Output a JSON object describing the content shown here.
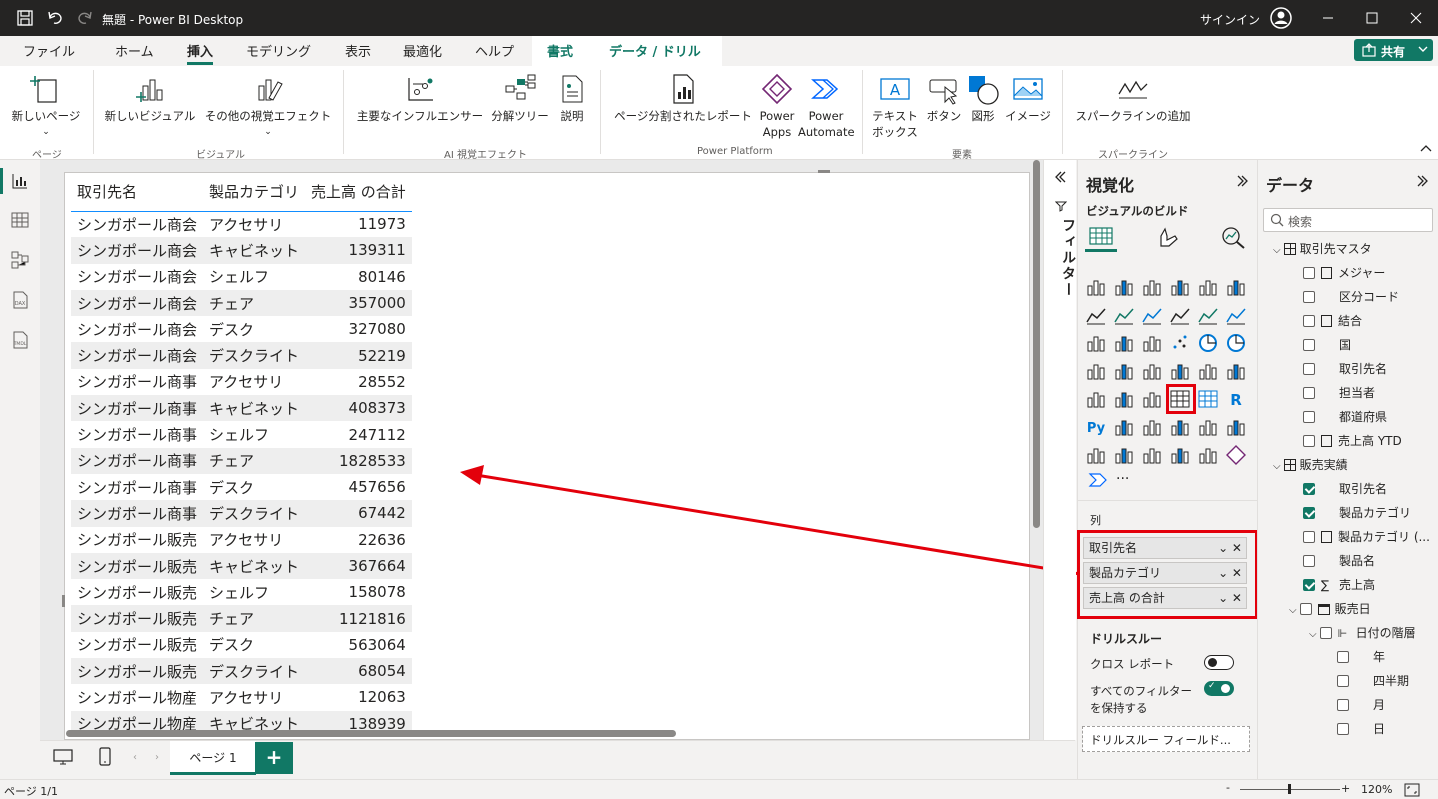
{
  "titlebar": {
    "title": "無題 - Power BI Desktop",
    "signin": "サインイン"
  },
  "tabs": [
    "ファイル",
    "ホーム",
    "挿入",
    "モデリング",
    "表示",
    "最適化",
    "ヘルプ",
    "書式",
    "データ / ドリル"
  ],
  "share_label": "共有",
  "ribbon": {
    "new_page": "新しいページ",
    "new_visual": "新しいビジュアル",
    "more_visuals": "その他の視覚エフェクト",
    "key_influencers": "主要なインフルエンサー",
    "decomp_tree": "分解ツリー",
    "narrative": "説明",
    "paginated": "ページ分割されたレポート",
    "power_apps_1": "Power",
    "power_apps_2": "Apps",
    "power_automate_1": "Power",
    "power_automate_2": "Automate",
    "textbox_1": "テキスト",
    "textbox_2": "ボックス",
    "buttons": "ボタン",
    "shapes": "図形",
    "image": "イメージ",
    "sparkline": "スパークラインの追加",
    "groups": {
      "page": "ページ",
      "visuals": "ビジュアル",
      "ai": "AI 視覚エフェクト",
      "platform": "Power Platform",
      "elements": "要素",
      "sparkline": "スパークライン"
    }
  },
  "table": {
    "headers": [
      "取引先名",
      "製品カテゴリ",
      "売上高 の合計"
    ],
    "rows": [
      [
        "シンガポール商会",
        "アクセサリ",
        "11973"
      ],
      [
        "シンガポール商会",
        "キャビネット",
        "139311"
      ],
      [
        "シンガポール商会",
        "シェルフ",
        "80146"
      ],
      [
        "シンガポール商会",
        "チェア",
        "357000"
      ],
      [
        "シンガポール商会",
        "デスク",
        "327080"
      ],
      [
        "シンガポール商会",
        "デスクライト",
        "52219"
      ],
      [
        "シンガポール商事",
        "アクセサリ",
        "28552"
      ],
      [
        "シンガポール商事",
        "キャビネット",
        "408373"
      ],
      [
        "シンガポール商事",
        "シェルフ",
        "247112"
      ],
      [
        "シンガポール商事",
        "チェア",
        "1828533"
      ],
      [
        "シンガポール商事",
        "デスク",
        "457656"
      ],
      [
        "シンガポール商事",
        "デスクライト",
        "67442"
      ],
      [
        "シンガポール販売",
        "アクセサリ",
        "22636"
      ],
      [
        "シンガポール販売",
        "キャビネット",
        "367664"
      ],
      [
        "シンガポール販売",
        "シェルフ",
        "158078"
      ],
      [
        "シンガポール販売",
        "チェア",
        "1121816"
      ],
      [
        "シンガポール販売",
        "デスク",
        "563064"
      ],
      [
        "シンガポール販売",
        "デスクライト",
        "68054"
      ],
      [
        "シンガポール物産",
        "アクセサリ",
        "12063"
      ],
      [
        "シンガポール物産",
        "キャビネット",
        "138939"
      ]
    ]
  },
  "pagebar": {
    "page_tab": "ページ 1",
    "add": "+"
  },
  "statusbar": {
    "page_count": "ページ 1/1",
    "zoom": "120%"
  },
  "filter_label": "フィルター",
  "viz": {
    "title": "視覚化",
    "build": "ビジュアルのビルド",
    "columns_label": "列",
    "wells": [
      "取引先名",
      "製品カテゴリ",
      "売上高 の合計"
    ],
    "drill_title": "ドリルスルー",
    "cross_report": "クロス レポート",
    "keep_filters_1": "すべてのフィルター",
    "keep_filters_2": "を保持する",
    "drill_field": "ドリルスルー フィールド...",
    "more": "···"
  },
  "data": {
    "title": "データ",
    "search_placeholder": "検索",
    "fields": [
      {
        "label": "取引先マスタ",
        "level": 0,
        "checked": false,
        "type": "table"
      },
      {
        "label": "メジャー",
        "level": 1,
        "checked": false,
        "type": "calc"
      },
      {
        "label": "区分コード",
        "level": 1,
        "checked": false,
        "type": "field"
      },
      {
        "label": "結合",
        "level": 1,
        "checked": false,
        "type": "calc"
      },
      {
        "label": "国",
        "level": 1,
        "checked": false,
        "type": "field"
      },
      {
        "label": "取引先名",
        "level": 1,
        "checked": false,
        "type": "field"
      },
      {
        "label": "担当者",
        "level": 1,
        "checked": false,
        "type": "field"
      },
      {
        "label": "都道府県",
        "level": 1,
        "checked": false,
        "type": "field"
      },
      {
        "label": "売上高 YTD",
        "level": 1,
        "checked": false,
        "type": "calc"
      },
      {
        "label": "販売実績",
        "level": 0,
        "checked": true,
        "type": "table"
      },
      {
        "label": "取引先名",
        "level": 1,
        "checked": true,
        "type": "field"
      },
      {
        "label": "製品カテゴリ",
        "level": 1,
        "checked": true,
        "type": "field"
      },
      {
        "label": "製品カテゴリ (...",
        "level": 1,
        "checked": false,
        "type": "calc"
      },
      {
        "label": "製品名",
        "level": 1,
        "checked": false,
        "type": "field"
      },
      {
        "label": "売上高",
        "level": 1,
        "checked": true,
        "type": "sum"
      },
      {
        "label": "販売日",
        "level": 1,
        "checked": false,
        "type": "date"
      },
      {
        "label": "日付の階層",
        "level": 2,
        "checked": false,
        "type": "hier"
      },
      {
        "label": "年",
        "level": 3,
        "checked": false,
        "type": "field"
      },
      {
        "label": "四半期",
        "level": 3,
        "checked": false,
        "type": "field"
      },
      {
        "label": "月",
        "level": 3,
        "checked": false,
        "type": "field"
      },
      {
        "label": "日",
        "level": 3,
        "checked": false,
        "type": "field"
      }
    ]
  },
  "colors": {
    "accent": "#117865",
    "highlight": "#e3000b"
  }
}
